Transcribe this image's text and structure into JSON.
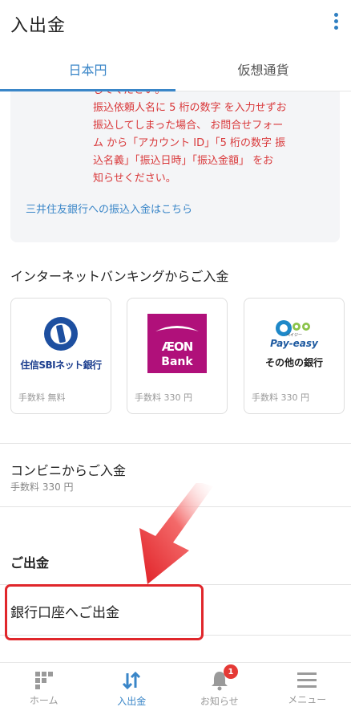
{
  "header": {
    "title": "入出金"
  },
  "tabs": [
    {
      "label": "日本円"
    },
    {
      "label": "仮想通貨"
    }
  ],
  "notice": {
    "lines": [
      "してください。",
      "振込依頼人名に 5 桁の数字 を入力せずお",
      "振込してしまった場合、 お問合せフォー",
      "ム から「アカウント ID」「5 桁の数字 振",
      "込名義」「振込日時」「振込金額」 をお",
      "知らせください。"
    ],
    "link": "三井住友銀行への振込入金はこちら"
  },
  "internet_banking": {
    "title": "インターネットバンキングからご入金",
    "cards": [
      {
        "name": "住信SBIネット銀行",
        "fee": "手数料 無料"
      },
      {
        "logo_word": "ÆON",
        "logo_sub": "Bank",
        "fee": "手数料 330 円"
      },
      {
        "logo_word": "Pay-easy",
        "logo_kana": "ペイジー",
        "name": "その他の銀行",
        "fee": "手数料 330 円"
      }
    ]
  },
  "convenience": {
    "title": "コンビニからご入金",
    "fee": "手数料 330 円"
  },
  "withdraw": {
    "title": "ご出金",
    "item": "銀行口座へご出金"
  },
  "bottom_nav": [
    {
      "label": "ホーム",
      "icon": "home-grid-icon"
    },
    {
      "label": "入出金",
      "icon": "transfer-arrows-icon"
    },
    {
      "label": "お知らせ",
      "icon": "bell-icon",
      "badge": "1"
    },
    {
      "label": "メニュー",
      "icon": "menu-icon"
    }
  ],
  "colors": {
    "accent": "#3a86c8",
    "notice_red": "#d9383a",
    "highlight": "#e0262b",
    "aeon": "#b0107a",
    "sbi": "#1d3f8f"
  }
}
